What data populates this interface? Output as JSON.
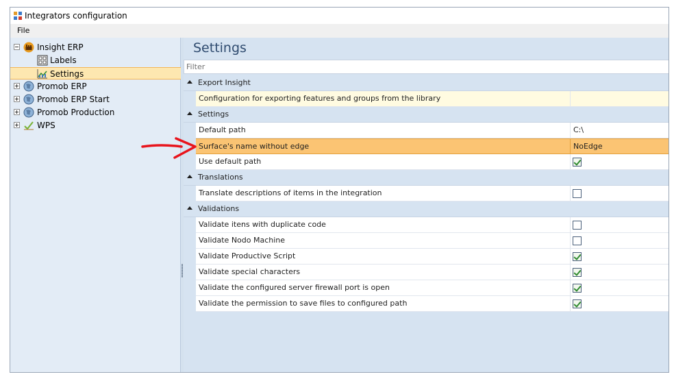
{
  "window": {
    "title": "Integrators configuration"
  },
  "menu": {
    "file_label": "File"
  },
  "tree": {
    "items": [
      {
        "label": "Insight ERP",
        "expanded": true,
        "icon": "factory-icon"
      },
      {
        "label": "Labels",
        "icon": "label-sheet-icon"
      },
      {
        "label": "Settings",
        "icon": "chart-icon",
        "selected": true
      },
      {
        "label": "Promob ERP",
        "icon": "globe-icon"
      },
      {
        "label": "Promob ERP Start",
        "icon": "globe-icon"
      },
      {
        "label": "Promob Production",
        "icon": "globe-icon"
      },
      {
        "label": "WPS",
        "icon": "check-mark-icon"
      }
    ]
  },
  "main": {
    "title": "Settings",
    "filter_placeholder": "Filter",
    "categories": [
      {
        "label": "Export Insight",
        "rows": [
          {
            "name": "Configuration for exporting features and groups from the library",
            "value": ""
          }
        ]
      },
      {
        "label": "Settings",
        "rows": [
          {
            "name": "Default path",
            "value": "C:\\"
          },
          {
            "name": "Surface's name without edge",
            "value": "NoEdge",
            "selected": true
          },
          {
            "name": "Use default path",
            "checked": true
          }
        ]
      },
      {
        "label": "Translations",
        "rows": [
          {
            "name": "Translate descriptions of items in the integration",
            "checked": false
          }
        ]
      },
      {
        "label": "Validations",
        "rows": [
          {
            "name": "Validate itens with duplicate code",
            "checked": false
          },
          {
            "name": "Validate Nodo Machine",
            "checked": false
          },
          {
            "name": "Validate Productive Script",
            "checked": true
          },
          {
            "name": "Validate special characters",
            "checked": true
          },
          {
            "name": "Validate the configured server firewall port is open",
            "checked": true
          },
          {
            "name": "Validate the permission to save files to configured path",
            "checked": true
          }
        ]
      }
    ]
  },
  "colors": {
    "selection": "#fbc473",
    "annotation_arrow": "#e8141c",
    "header_text": "#2e4a6e"
  }
}
